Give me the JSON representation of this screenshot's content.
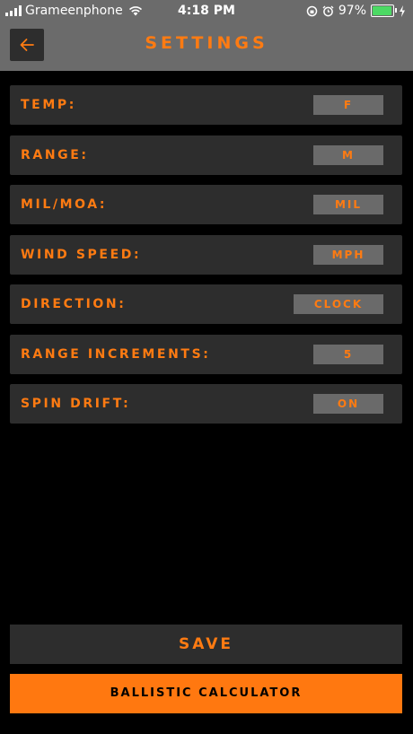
{
  "status_bar": {
    "carrier": "Grameenphone",
    "time": "4:18 PM",
    "battery": "97%",
    "battery_level": 0.97
  },
  "header": {
    "back_icon": "arrow-left-icon",
    "title": "SETTINGS"
  },
  "settings": [
    {
      "label": "TEMP:",
      "value": "F"
    },
    {
      "label": "RANGE:",
      "value": "M"
    },
    {
      "label": "MIL/MOA:",
      "value": "MIL"
    },
    {
      "label": "WIND SPEED:",
      "value": "MPH"
    },
    {
      "label": "DIRECTION:",
      "value": "CLOCK"
    },
    {
      "label": "RANGE INCREMENTS:",
      "value": "5"
    },
    {
      "label": "SPIN DRIFT:",
      "value": "ON"
    }
  ],
  "buttons": {
    "save": "SAVE",
    "ballistic_calculator": "BALLISTIC CALCULATOR"
  },
  "colors": {
    "accent": "#ff7b12",
    "panel": "#2d2d2d",
    "header": "#6b6b6b"
  }
}
